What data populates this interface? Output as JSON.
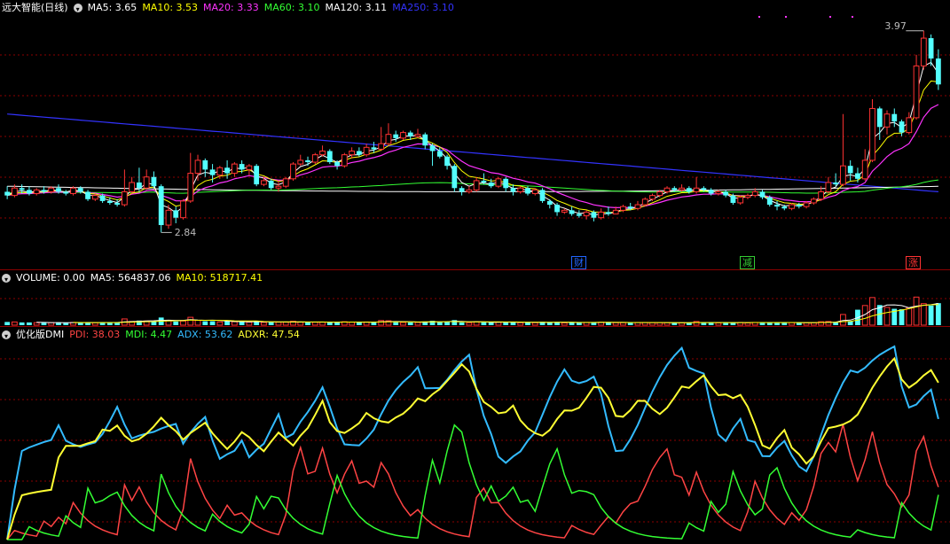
{
  "colors": {
    "up": "#ff3333",
    "down": "#54ffff",
    "ma5": "#ffffff",
    "ma10": "#ffff00",
    "ma20": "#ff33ff",
    "ma60": "#33ff33",
    "ma120": "#ffffff",
    "ma250": "#3333ff",
    "pdi": "#ff4444",
    "mdi": "#33ff33",
    "adx": "#33bbff",
    "adxr": "#ffff33",
    "grid": "#8b0000"
  },
  "price_panel": {
    "title": "远大智能(日线)",
    "legend": [
      {
        "label": "MA5: 3.65",
        "color": "#ffffff"
      },
      {
        "label": "MA10: 3.53",
        "color": "#ffff00"
      },
      {
        "label": "MA20: 3.33",
        "color": "#ff33ff"
      },
      {
        "label": "MA60: 3.10",
        "color": "#33ff33"
      },
      {
        "label": "MA120: 3.11",
        "color": "#ffffff"
      },
      {
        "label": "MA250: 3.10",
        "color": "#3333ff"
      }
    ],
    "high_label": "3.97",
    "low_label": "2.84",
    "event_tags": [
      {
        "text": "财",
        "color": "#2266ff"
      },
      {
        "text": "减",
        "color": "#33cc33"
      },
      {
        "text": "涨",
        "color": "#ff3333"
      }
    ]
  },
  "volume_panel": {
    "legend": [
      {
        "label": "VOLUME: 0.00",
        "color": "#ffffff"
      },
      {
        "label": "MA5: 564837.06",
        "color": "#ffffff"
      },
      {
        "label": "MA10: 518717.41",
        "color": "#ffff00"
      }
    ]
  },
  "dmi_panel": {
    "title": "优化版DMI",
    "legend": [
      {
        "label": "PDI: 38.03",
        "color": "#ff4444"
      },
      {
        "label": "MDI: 4.47",
        "color": "#33ff33"
      },
      {
        "label": "ADX: 53.62",
        "color": "#33bbff"
      },
      {
        "label": "ADXR: 47.54",
        "color": "#ffff33"
      }
    ]
  },
  "chart_data": [
    {
      "type": "candlestick",
      "title": "远大智能(日线)",
      "ylim": [
        2.7,
        4.05
      ],
      "low": 2.84,
      "high": 3.97,
      "ma_latest": {
        "MA5": 3.65,
        "MA10": 3.53,
        "MA20": 3.33,
        "MA60": 3.1,
        "MA120": 3.11,
        "MA250": 3.1
      },
      "candles": [
        [
          3.1,
          3.08,
          3.13,
          3.06
        ],
        [
          3.08,
          3.12,
          3.14,
          3.07
        ],
        [
          3.12,
          3.11,
          3.14,
          3.09
        ],
        [
          3.11,
          3.09,
          3.13,
          3.08
        ],
        [
          3.09,
          3.11,
          3.12,
          3.08
        ],
        [
          3.11,
          3.1,
          3.13,
          3.09
        ],
        [
          3.1,
          3.12,
          3.13,
          3.09
        ],
        [
          3.12,
          3.1,
          3.14,
          3.09
        ],
        [
          3.1,
          3.09,
          3.11,
          3.08
        ],
        [
          3.09,
          3.12,
          3.13,
          3.08
        ],
        [
          3.12,
          3.1,
          3.13,
          3.09
        ],
        [
          3.1,
          3.06,
          3.11,
          3.05
        ],
        [
          3.06,
          3.08,
          3.09,
          3.05
        ],
        [
          3.08,
          3.05,
          3.09,
          3.04
        ],
        [
          3.05,
          3.04,
          3.07,
          3.03
        ],
        [
          3.04,
          3.03,
          3.06,
          3.02
        ],
        [
          3.03,
          3.1,
          3.22,
          3.02
        ],
        [
          3.1,
          3.15,
          3.18,
          3.09
        ],
        [
          3.15,
          3.12,
          3.23,
          3.1
        ],
        [
          3.12,
          3.18,
          3.22,
          3.11
        ],
        [
          3.18,
          3.13,
          3.21,
          3.12
        ],
        [
          3.13,
          2.92,
          3.14,
          2.88
        ],
        [
          2.92,
          3.0,
          3.03,
          2.9
        ],
        [
          3.0,
          2.96,
          3.02,
          2.93
        ],
        [
          2.96,
          3.05,
          3.06,
          2.95
        ],
        [
          3.05,
          3.2,
          3.31,
          3.04
        ],
        [
          3.2,
          3.27,
          3.3,
          3.16
        ],
        [
          3.27,
          3.22,
          3.28,
          3.18
        ],
        [
          3.22,
          3.19,
          3.25,
          3.15
        ],
        [
          3.19,
          3.23,
          3.24,
          3.17
        ],
        [
          3.23,
          3.2,
          3.27,
          3.17
        ],
        [
          3.2,
          3.25,
          3.26,
          3.18
        ],
        [
          3.25,
          3.22,
          3.27,
          3.2
        ],
        [
          3.22,
          3.24,
          3.25,
          3.19
        ],
        [
          3.24,
          3.14,
          3.25,
          3.13
        ],
        [
          3.14,
          3.16,
          3.18,
          3.13
        ],
        [
          3.16,
          3.12,
          3.17,
          3.11
        ],
        [
          3.12,
          3.13,
          3.16,
          3.1
        ],
        [
          3.13,
          3.17,
          3.18,
          3.12
        ],
        [
          3.17,
          3.25,
          3.26,
          3.16
        ],
        [
          3.25,
          3.27,
          3.3,
          3.24
        ],
        [
          3.27,
          3.26,
          3.29,
          3.24
        ],
        [
          3.26,
          3.3,
          3.31,
          3.25
        ],
        [
          3.3,
          3.32,
          3.35,
          3.29
        ],
        [
          3.32,
          3.26,
          3.33,
          3.25
        ],
        [
          3.26,
          3.24,
          3.27,
          3.22
        ],
        [
          3.24,
          3.3,
          3.31,
          3.23
        ],
        [
          3.3,
          3.32,
          3.34,
          3.28
        ],
        [
          3.32,
          3.3,
          3.34,
          3.29
        ],
        [
          3.3,
          3.34,
          3.36,
          3.29
        ],
        [
          3.34,
          3.33,
          3.37,
          3.31
        ],
        [
          3.33,
          3.36,
          3.45,
          3.32
        ],
        [
          3.36,
          3.41,
          3.47,
          3.35
        ],
        [
          3.41,
          3.39,
          3.43,
          3.37
        ],
        [
          3.39,
          3.42,
          3.43,
          3.38
        ],
        [
          3.42,
          3.4,
          3.43,
          3.38
        ],
        [
          3.4,
          3.41,
          3.44,
          3.39
        ],
        [
          3.41,
          3.35,
          3.42,
          3.33
        ],
        [
          3.35,
          3.32,
          3.36,
          3.24
        ],
        [
          3.32,
          3.29,
          3.34,
          3.28
        ],
        [
          3.29,
          3.24,
          3.3,
          3.22
        ],
        [
          3.24,
          3.12,
          3.25,
          3.1
        ],
        [
          3.12,
          3.1,
          3.13,
          3.08
        ],
        [
          3.1,
          3.11,
          3.13,
          3.09
        ],
        [
          3.11,
          3.16,
          3.18,
          3.1
        ],
        [
          3.16,
          3.15,
          3.2,
          3.14
        ],
        [
          3.15,
          3.13,
          3.17,
          3.12
        ],
        [
          3.13,
          3.17,
          3.18,
          3.12
        ],
        [
          3.17,
          3.12,
          3.18,
          3.1
        ],
        [
          3.12,
          3.1,
          3.14,
          3.08
        ],
        [
          3.1,
          3.12,
          3.13,
          3.09
        ],
        [
          3.12,
          3.09,
          3.13,
          3.08
        ],
        [
          3.09,
          3.11,
          3.12,
          3.08
        ],
        [
          3.11,
          3.05,
          3.12,
          3.04
        ],
        [
          3.05,
          3.03,
          3.06,
          3.01
        ],
        [
          3.03,
          2.99,
          3.04,
          2.97
        ],
        [
          2.99,
          3.0,
          3.01,
          2.98
        ],
        [
          3.0,
          2.98,
          3.02,
          2.97
        ],
        [
          2.98,
          2.97,
          3.0,
          2.96
        ],
        [
          2.97,
          2.99,
          3.0,
          2.95
        ],
        [
          2.99,
          2.96,
          3.0,
          2.94
        ],
        [
          2.96,
          2.99,
          3.01,
          2.95
        ],
        [
          2.99,
          2.98,
          3.02,
          2.97
        ],
        [
          2.98,
          3.0,
          3.02,
          2.98
        ],
        [
          3.0,
          3.02,
          3.03,
          2.99
        ],
        [
          3.02,
          3.01,
          3.04,
          3.0
        ],
        [
          3.01,
          3.03,
          3.05,
          3.0
        ],
        [
          3.03,
          3.06,
          3.07,
          3.02
        ],
        [
          3.06,
          3.08,
          3.09,
          3.05
        ],
        [
          3.08,
          3.1,
          3.11,
          3.07
        ],
        [
          3.1,
          3.12,
          3.13,
          3.09
        ],
        [
          3.12,
          3.11,
          3.13,
          3.1
        ],
        [
          3.11,
          3.12,
          3.14,
          3.1
        ],
        [
          3.12,
          3.1,
          3.13,
          3.09
        ],
        [
          3.1,
          3.12,
          3.18,
          3.09
        ],
        [
          3.12,
          3.11,
          3.13,
          3.1
        ],
        [
          3.11,
          3.09,
          3.12,
          3.08
        ],
        [
          3.09,
          3.1,
          3.11,
          3.08
        ],
        [
          3.1,
          3.08,
          3.11,
          3.07
        ],
        [
          3.08,
          3.04,
          3.09,
          3.03
        ],
        [
          3.04,
          3.07,
          3.08,
          3.03
        ],
        [
          3.07,
          3.08,
          3.09,
          3.06
        ],
        [
          3.08,
          3.1,
          3.12,
          3.07
        ],
        [
          3.1,
          3.07,
          3.11,
          3.06
        ],
        [
          3.07,
          3.03,
          3.08,
          3.02
        ],
        [
          3.03,
          3.02,
          3.05,
          3.0
        ],
        [
          3.02,
          3.01,
          3.03,
          3.0
        ],
        [
          3.01,
          3.03,
          3.04,
          3.0
        ],
        [
          3.03,
          3.02,
          3.04,
          3.01
        ],
        [
          3.02,
          3.04,
          3.05,
          3.01
        ],
        [
          3.04,
          3.06,
          3.07,
          3.03
        ],
        [
          3.06,
          3.1,
          3.13,
          3.05
        ],
        [
          3.1,
          3.15,
          3.18,
          3.09
        ],
        [
          3.15,
          3.14,
          3.2,
          3.13
        ],
        [
          3.14,
          3.24,
          3.52,
          3.13
        ],
        [
          3.24,
          3.2,
          3.27,
          3.16
        ],
        [
          3.2,
          3.17,
          3.23,
          3.15
        ],
        [
          3.17,
          3.27,
          3.33,
          3.16
        ],
        [
          3.27,
          3.55,
          3.6,
          3.26
        ],
        [
          3.55,
          3.45,
          3.56,
          3.38
        ],
        [
          3.45,
          3.52,
          3.54,
          3.41
        ],
        [
          3.52,
          3.48,
          3.55,
          3.45
        ],
        [
          3.48,
          3.42,
          3.49,
          3.4
        ],
        [
          3.42,
          3.5,
          3.53,
          3.41
        ],
        [
          3.5,
          3.78,
          3.84,
          3.49
        ],
        [
          3.78,
          3.93,
          3.97,
          3.76
        ],
        [
          3.93,
          3.82,
          3.95,
          3.78
        ],
        [
          3.82,
          3.68,
          3.87,
          3.65
        ]
      ]
    },
    {
      "type": "bar",
      "title": "VOLUME",
      "ma_latest": {
        "MA5": 564837.06,
        "MA10": 518717.41
      }
    },
    {
      "type": "line",
      "title": "优化版DMI",
      "latest": {
        "PDI": 38.03,
        "MDI": 4.47,
        "ADX": 53.62,
        "ADXR": 47.54
      }
    }
  ]
}
